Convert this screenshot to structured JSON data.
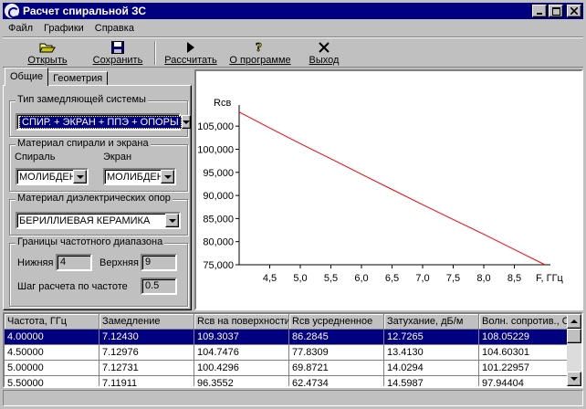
{
  "window": {
    "title": "Расчет спиральной ЗС"
  },
  "menu": {
    "items": [
      "Файл",
      "Графики",
      "Справка"
    ]
  },
  "toolbar": {
    "open": "Открыть",
    "save": "Сохранить",
    "calc": "Рассчитать",
    "about": "О программе",
    "exit": "Выход"
  },
  "tabs": {
    "general": "Общие",
    "geometry": "Геометрия"
  },
  "slow_wave": {
    "title": "Тип замедляющей системы",
    "value": "СПИР. + ЭКРАН + ППЭ + ОПОРЫ"
  },
  "material": {
    "title": "Материал спирали и экрана",
    "spiral_label": "Спираль",
    "screen_label": "Экран",
    "spiral_value": "МОЛИБДЕН",
    "screen_value": "МОЛИБДЕН"
  },
  "dielectric": {
    "title": "Материал диэлектрических опор",
    "value": "БЕРИЛЛИЕВАЯ КЕРАМИКА"
  },
  "freq": {
    "title": "Границы частотного диапазона",
    "lower_label": "Нижняя",
    "lower_value": "4",
    "upper_label": "Верхняя",
    "upper_value": "9",
    "step_label": "Шаг расчета по частоте",
    "step_value": "0.5"
  },
  "chart_data": {
    "type": "line",
    "ylabel": "Rсв",
    "xlabel": "F, ГГц",
    "xlim": [
      4.0,
      9.0
    ],
    "ylim": [
      75000,
      108000
    ],
    "xticks": [
      "4,5",
      "5,0",
      "5,5",
      "6,0",
      "6,5",
      "7,0",
      "7,5",
      "8,0",
      "8,5"
    ],
    "yticks": [
      "75,000",
      "80,000",
      "85,000",
      "90,000",
      "95,000",
      "100,000",
      "105,000"
    ],
    "line_color": "#ff0000",
    "series": [
      {
        "x": [
          4.0,
          4.5,
          5.0,
          5.5,
          6.0,
          6.5,
          7.0,
          7.5,
          8.0,
          8.5,
          9.0
        ],
        "values": [
          108052,
          104603,
          101230,
          97944,
          94600,
          91300,
          88000,
          84800,
          81600,
          78300,
          75000
        ]
      }
    ]
  },
  "table": {
    "columns": [
      "Частота, ГГц",
      "Замедление",
      "Rсв на поверхности",
      "Rсв усредненное",
      "Затухание, дБ/м",
      "Волн. сопротив., Ом"
    ],
    "rows": [
      [
        "4.00000",
        "7.12430",
        "109.3037",
        "86.2845",
        "12.7265",
        "108.05229"
      ],
      [
        "4.50000",
        "7.12976",
        "104.7476",
        "77.8309",
        "13.4130",
        "104.60301"
      ],
      [
        "5.00000",
        "7.12731",
        "100.4296",
        "69.8721",
        "14.0294",
        "101.22957"
      ],
      [
        "5.50000",
        "7.11911",
        "96.3552",
        "62.4734",
        "14.5987",
        "97.94404"
      ]
    ]
  }
}
